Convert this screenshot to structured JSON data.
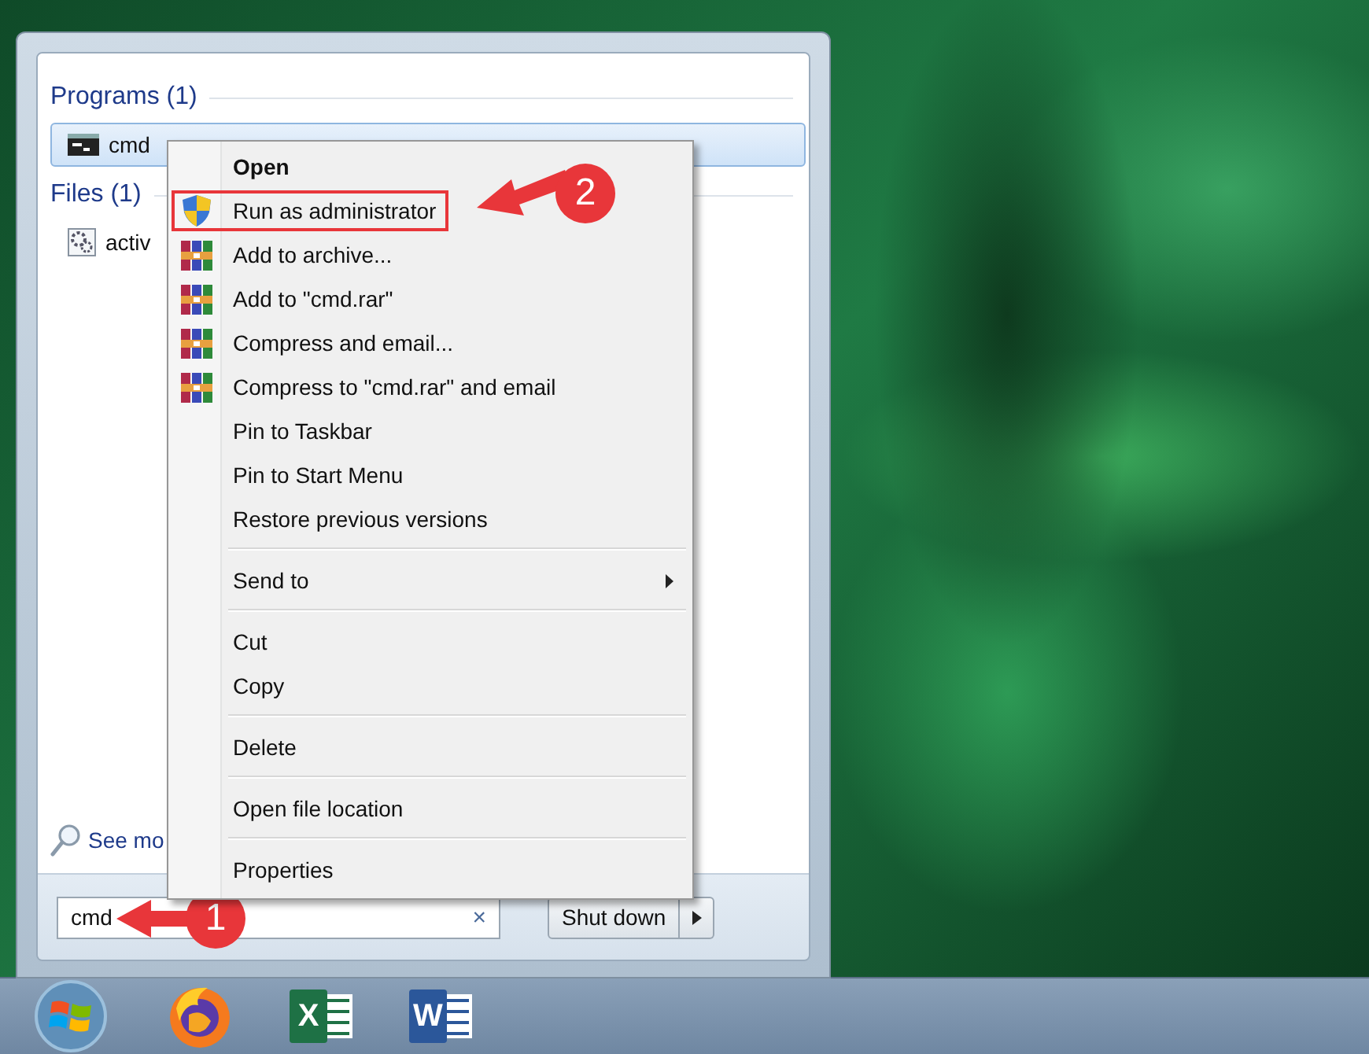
{
  "start_menu": {
    "sections": [
      {
        "heading": "Programs (1)",
        "results": [
          {
            "label": "cmd",
            "kind": "program",
            "selected": true
          }
        ]
      },
      {
        "heading": "Files (1)",
        "results": [
          {
            "label": "activ",
            "kind": "file",
            "selected": false
          }
        ]
      }
    ],
    "see_more": "See mo",
    "search": {
      "value": "cmd",
      "clear": "×",
      "callout": "1"
    },
    "shutdown": {
      "label": "Shut down"
    }
  },
  "context_menu": {
    "items": [
      {
        "kind": "item",
        "label": "Open",
        "default": true
      },
      {
        "kind": "admin",
        "label": "Run as administrator",
        "callout": "2"
      },
      {
        "kind": "archive",
        "label": "Add to archive..."
      },
      {
        "kind": "archive",
        "label": "Add to \"cmd.rar\""
      },
      {
        "kind": "archive",
        "label": "Compress and email..."
      },
      {
        "kind": "archive",
        "label": "Compress to \"cmd.rar\" and email"
      },
      {
        "kind": "item",
        "label": "Pin to Taskbar"
      },
      {
        "kind": "item",
        "label": "Pin to Start Menu"
      },
      {
        "kind": "item",
        "label": "Restore previous versions"
      },
      {
        "kind": "separator"
      },
      {
        "kind": "item",
        "label": "Send to",
        "submenu": true
      },
      {
        "kind": "separator"
      },
      {
        "kind": "item",
        "label": "Cut"
      },
      {
        "kind": "item",
        "label": "Copy"
      },
      {
        "kind": "separator"
      },
      {
        "kind": "item",
        "label": "Delete"
      },
      {
        "kind": "separator"
      },
      {
        "kind": "item",
        "label": "Open file location"
      },
      {
        "kind": "separator"
      },
      {
        "kind": "item",
        "label": "Properties"
      }
    ]
  },
  "taskbar": {
    "items": [
      {
        "kind": "start"
      },
      {
        "kind": "browser"
      },
      {
        "kind": "spreadsheet",
        "glyph": "X"
      },
      {
        "kind": "document",
        "glyph": "W"
      }
    ]
  }
}
